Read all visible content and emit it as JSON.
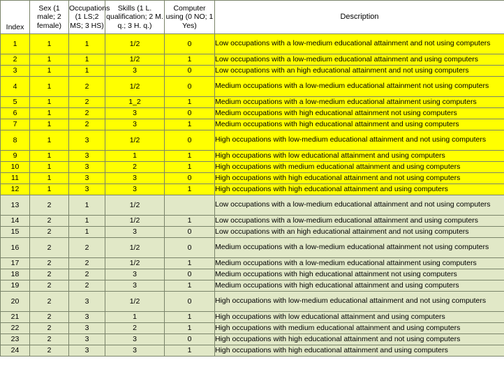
{
  "table": {
    "headers": {
      "index": "Index",
      "sex": "Sex (1 male; 2 female)",
      "occupations": "Occupations (1 LS;2 MS; 3 HS)",
      "skills": "Skills (1 L. qualification; 2 M. q.; 3 H. q.)",
      "computer": "Computer using (0 NO; 1 Yes)",
      "description": "Description"
    },
    "colors": {
      "group_1_background": "#FFFF00",
      "group_2_background": "#E1E8C7",
      "border": "#7A846A",
      "text": "#000000"
    },
    "column_order": [
      "index",
      "sex",
      "occupations",
      "skills",
      "computer",
      "description"
    ],
    "rows": [
      {
        "index": "1",
        "sex": "1",
        "occupations": "1",
        "skills": "1/2",
        "computer": "0",
        "description": "Low occupations with a low-medium educational attainment and not using computers",
        "group": "y",
        "lines": 2
      },
      {
        "index": "2",
        "sex": "1",
        "occupations": "1",
        "skills": "1/2",
        "computer": "1",
        "description": "Low occupations with a low-medium educational attainment and using computers",
        "group": "y",
        "lines": 1
      },
      {
        "index": "3",
        "sex": "1",
        "occupations": "1",
        "skills": "3",
        "computer": "0",
        "description": "Low occupations with an high educational attainment and not using computers",
        "group": "y",
        "lines": 1
      },
      {
        "index": "4",
        "sex": "1",
        "occupations": "2",
        "skills": "1/2",
        "computer": "0",
        "description": "Medium occupations with a low-medium educational attainment not using computers",
        "group": "y",
        "lines": 2
      },
      {
        "index": "5",
        "sex": "1",
        "occupations": "2",
        "skills": "1_2",
        "computer": "1",
        "description": "Medium occupations with a low-medium educational attainment using computers",
        "group": "y",
        "lines": 1
      },
      {
        "index": "6",
        "sex": "1",
        "occupations": "2",
        "skills": "3",
        "computer": "0",
        "description": "Medium occupations with high educational attainment not using computers",
        "group": "y",
        "lines": 1
      },
      {
        "index": "7",
        "sex": "1",
        "occupations": "2",
        "skills": "3",
        "computer": "1",
        "description": "Medium occupations with high educational attainment and using computers",
        "group": "y",
        "lines": 1
      },
      {
        "index": "8",
        "sex": "1",
        "occupations": "3",
        "skills": "1/2",
        "computer": "0",
        "description": "High occupations with low-medium educational attainment and not using computers",
        "group": "y",
        "lines": 2
      },
      {
        "index": "9",
        "sex": "1",
        "occupations": "3",
        "skills": "1",
        "computer": "1",
        "description": "High occupations with low educational attainment and using computers",
        "group": "y",
        "lines": 1
      },
      {
        "index": "10",
        "sex": "1",
        "occupations": "3",
        "skills": "2",
        "computer": "1",
        "description": "High occupations with medium educational attainment and using computers",
        "group": "y",
        "lines": 1
      },
      {
        "index": "11",
        "sex": "1",
        "occupations": "3",
        "skills": "3",
        "computer": "0",
        "description": "High occupations with high educational attainment and not using computers",
        "group": "y",
        "lines": 1
      },
      {
        "index": "12",
        "sex": "1",
        "occupations": "3",
        "skills": "3",
        "computer": "1",
        "description": "High occupations with high educational attainment and using computers",
        "group": "y",
        "lines": 1
      },
      {
        "index": "13",
        "sex": "2",
        "occupations": "1",
        "skills": "1/2",
        "computer": "",
        "description": "Low occupations with a low-medium educational attainment and not using computers",
        "group": "g",
        "lines": 2
      },
      {
        "index": "14",
        "sex": "2",
        "occupations": "1",
        "skills": "1/2",
        "computer": "1",
        "description": "Low occupations with a low-medium educational attainment and using computers",
        "group": "g",
        "lines": 1
      },
      {
        "index": "15",
        "sex": "2",
        "occupations": "1",
        "skills": "3",
        "computer": "0",
        "description": "Low occupations with an high educational attainment and not using computers",
        "group": "g",
        "lines": 1
      },
      {
        "index": "16",
        "sex": "2",
        "occupations": "2",
        "skills": "1/2",
        "computer": "0",
        "description": "Medium occupations with a low-medium educational attainment not using computers",
        "group": "g",
        "lines": 2
      },
      {
        "index": "17",
        "sex": "2",
        "occupations": "2",
        "skills": "1/2",
        "computer": "1",
        "description": "Medium occupations with a low-medium educational attainment using computers",
        "group": "g",
        "lines": 1
      },
      {
        "index": "18",
        "sex": "2",
        "occupations": "2",
        "skills": "3",
        "computer": "0",
        "description": "Medium occupations with high educational attainment not using computers",
        "group": "g",
        "lines": 1
      },
      {
        "index": "19",
        "sex": "2",
        "occupations": "2",
        "skills": "3",
        "computer": "1",
        "description": "Medium occupations with high educational attainment and using computers",
        "group": "g",
        "lines": 1
      },
      {
        "index": "20",
        "sex": "2",
        "occupations": "3",
        "skills": "1/2",
        "computer": "0",
        "description": "High occupations with low-medium educational attainment and not using computers",
        "group": "g",
        "lines": 2
      },
      {
        "index": "21",
        "sex": "2",
        "occupations": "3",
        "skills": "1",
        "computer": "1",
        "description": "High occupations with low educational attainment and using computers",
        "group": "g",
        "lines": 1
      },
      {
        "index": "22",
        "sex": "2",
        "occupations": "3",
        "skills": "2",
        "computer": "1",
        "description": "High occupations with medium educational attainment and using computers",
        "group": "g",
        "lines": 1
      },
      {
        "index": "23",
        "sex": "2",
        "occupations": "3",
        "skills": "3",
        "computer": "0",
        "description": "High occupations with high educational attainment and not using computers",
        "group": "g",
        "lines": 1
      },
      {
        "index": "24",
        "sex": "2",
        "occupations": "3",
        "skills": "3",
        "computer": "1",
        "description": "High occupations with high educational attainment and using computers",
        "group": "g",
        "lines": 1
      }
    ]
  }
}
